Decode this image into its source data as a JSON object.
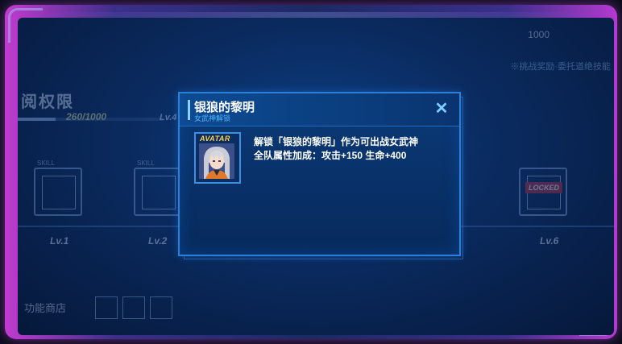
{
  "background": {
    "section_title": "阅权限",
    "progress_text": "260/1000",
    "progress_fraction": 0.26,
    "level_top": "Lv.4",
    "gold_value": "1000",
    "top_right_hint": "※挑战奖励·委托道绝技能",
    "skill_tag": "SKILL",
    "levels": [
      "Lv.1",
      "Lv.2",
      "Lv.6"
    ],
    "locked_label": "LOCKED",
    "bottom_label": "功能商店"
  },
  "dialog": {
    "title": "银狼的黎明",
    "subtitle": "女武神解锁",
    "close_icon": "close-icon",
    "avatar_tag": "AVATAR",
    "reward_line1": "解锁「银狼的黎明」作为可出战女武神",
    "reward_line2": "全队属性加成：攻击+150  生命+400"
  },
  "colors": {
    "accent": "#2a7fd8",
    "title_accent": "#8cd0ff",
    "subtitle": "#4fb6ff",
    "avatar_tag": "#ffd24a",
    "frame_purple": "#c23bd0"
  }
}
